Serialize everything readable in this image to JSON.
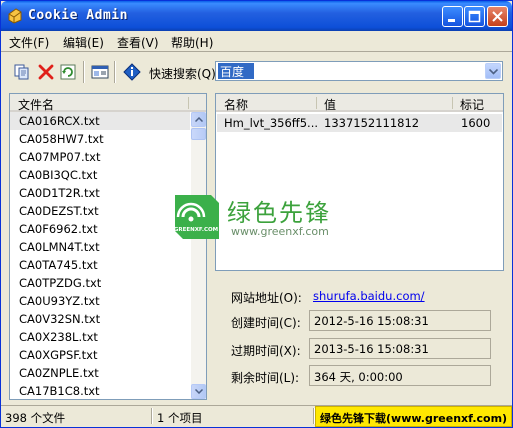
{
  "window": {
    "title": "Cookie Admin"
  },
  "menu": {
    "file": "文件(F)",
    "edit": "编辑(E)",
    "view": "查看(V)",
    "help": "帮助(H)"
  },
  "toolbar": {
    "search_label": "快速搜索(Q)",
    "search_value": "百度",
    "icons": [
      "copy-icon",
      "delete-icon",
      "refresh-icon",
      "properties-icon",
      "info-icon"
    ]
  },
  "file_list": {
    "header": "文件名",
    "items": [
      "CA016RCX.txt",
      "CA058HW7.txt",
      "CA07MP07.txt",
      "CA0BI3QC.txt",
      "CA0D1T2R.txt",
      "CA0DEZST.txt",
      "CA0F6962.txt",
      "CA0LMN4T.txt",
      "CA0TA745.txt",
      "CA0TPZDG.txt",
      "CA0U93YZ.txt",
      "CA0V32SN.txt",
      "CA0X238L.txt",
      "CA0XGPSF.txt",
      "CA0ZNPLE.txt",
      "CA17B1C8.txt"
    ]
  },
  "cookie_list": {
    "headers": {
      "name": "名称",
      "value": "值",
      "mark": "标记"
    },
    "rows": [
      {
        "name": "Hm_lvt_356ff5...",
        "value": "1337152111812",
        "mark": "1600"
      }
    ]
  },
  "details": {
    "site_label": "网站地址(O):",
    "site_value": "shurufa.baidu.com/",
    "created_label": "创建时间(C):",
    "created_value": "2012-5-16 15:08:31",
    "expires_label": "过期时间(X):",
    "expires_value": "2013-5-16 15:08:31",
    "remaining_label": "剩余时间(L):",
    "remaining_value": "364 天, 0:00:00"
  },
  "status": {
    "file_count": "398 个文件",
    "item_count": "1 个项目",
    "banner": "绿色先锋下载(www.greenxf.com)"
  },
  "watermark": {
    "title": "绿色先锋",
    "url": "www.greenxf.com",
    "logo_text": "GREENXF.COM"
  }
}
